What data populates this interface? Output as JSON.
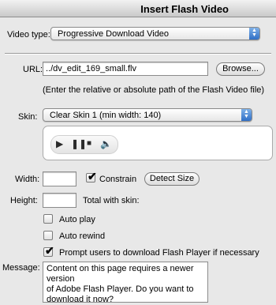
{
  "window": {
    "title": "Insert Flash Video"
  },
  "video_type": {
    "label": "Video type:",
    "selected": "Progressive Download Video"
  },
  "url": {
    "label": "URL:",
    "value": "../dv_edit_169_small.flv",
    "browse_label": "Browse...",
    "hint": "(Enter the relative or absolute path of the Flash Video file)"
  },
  "skin": {
    "label": "Skin:",
    "selected": "Clear Skin 1 (min width: 140)",
    "controls": [
      "play-icon",
      "pause-icon",
      "stop-icon",
      "volume-icon"
    ]
  },
  "size": {
    "width_label": "Width:",
    "width_value": "",
    "constrain_label": "Constrain",
    "constrain_checked": true,
    "detect_label": "Detect Size",
    "height_label": "Height:",
    "height_value": "",
    "total_label": "Total with skin:"
  },
  "options": {
    "auto_play_label": "Auto play",
    "auto_play_checked": false,
    "auto_rewind_label": "Auto rewind",
    "auto_rewind_checked": false,
    "prompt_label": "Prompt users to download Flash Player if necessary",
    "prompt_checked": true
  },
  "message": {
    "label": "Message:",
    "value": "Content on this page requires a newer version\nof Adobe Flash Player. Do you want to\ndownload it now?"
  }
}
